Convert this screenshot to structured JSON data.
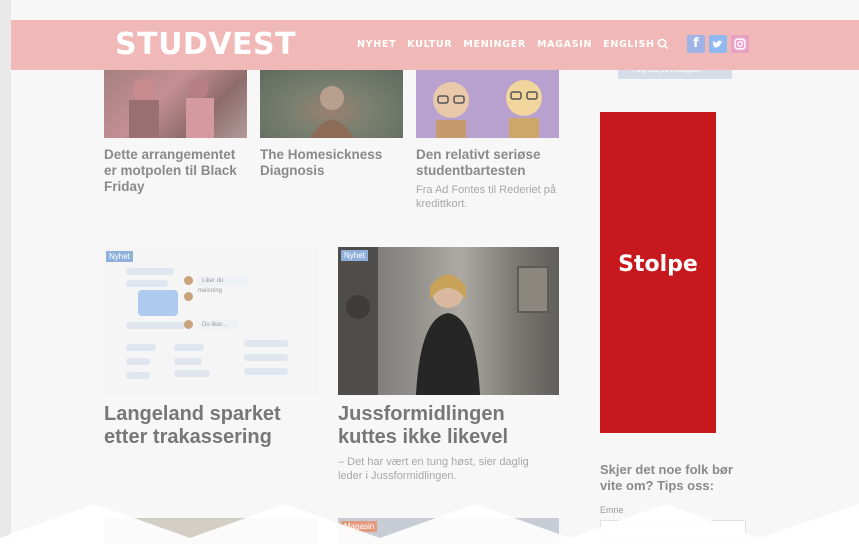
{
  "header": {
    "logo": "STUDVEST",
    "nav": [
      "NYHET",
      "KULTUR",
      "MENINGER",
      "MAGASIN",
      "ENGLISH"
    ],
    "icons": [
      "search-icon",
      "facebook-icon",
      "twitter-icon",
      "instagram-icon"
    ],
    "bg_color": "#f0b9b7"
  },
  "top_articles": [
    {
      "title": "Dette arrangementet er motpolen til Black Friday",
      "subtitle": ""
    },
    {
      "title": "The Homesickness Diagnosis",
      "subtitle": ""
    },
    {
      "title": "Den relativt seriøse studentbartesten",
      "subtitle": "Fra Ad Fontes til Rederiet på kredittkort."
    }
  ],
  "mid_articles": [
    {
      "tag": "Nyhet",
      "title": "Langeland sparket etter trakassering",
      "subtitle": ""
    },
    {
      "tag": "Nyhet",
      "title": "Jussformidlingen kuttes ikke likevel",
      "subtitle": "– Det har vært en tung høst, sier daglig leder i Jussformidlingen."
    }
  ],
  "chat_mock": {
    "bubble1": "Liker du meisning",
    "bubble2": "Du liker..."
  },
  "bottom_articles": [
    {
      "tag": ""
    },
    {
      "tag": "Magasin"
    }
  ],
  "sidebar": {
    "instagram_button": "Følg oss på Instagram",
    "ad_label": "Stolpe",
    "ad_color": "#c7191d",
    "tips_heading": "Skjer det noe folk bør vite om? Tips oss:",
    "field_label": "Emne"
  }
}
